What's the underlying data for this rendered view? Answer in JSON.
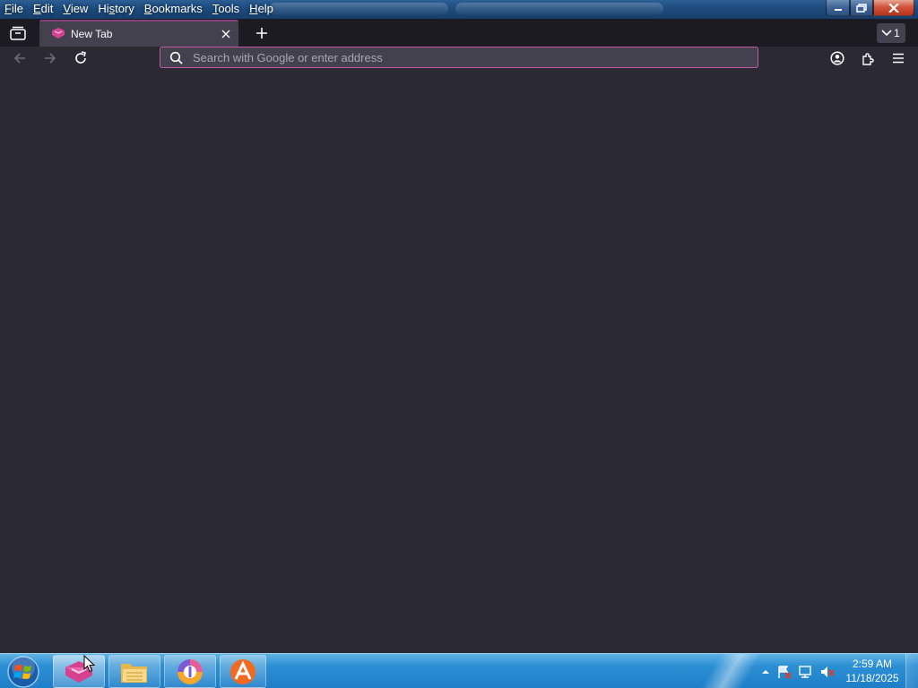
{
  "menubar": {
    "items": [
      {
        "pre": "",
        "key": "F",
        "post": "ile"
      },
      {
        "pre": "",
        "key": "E",
        "post": "dit"
      },
      {
        "pre": "",
        "key": "V",
        "post": "iew"
      },
      {
        "pre": "Hi",
        "key": "s",
        "post": "tory"
      },
      {
        "pre": "",
        "key": "B",
        "post": "ookmarks"
      },
      {
        "pre": "",
        "key": "T",
        "post": "ools"
      },
      {
        "pre": "",
        "key": "H",
        "post": "elp"
      }
    ]
  },
  "tabs": {
    "active_title": "New Tab",
    "tab_count": "1"
  },
  "urlbar": {
    "placeholder": "Search with Google or enter address",
    "value": ""
  },
  "taskbar": {
    "clock_time": "2:59 AM",
    "clock_date": "11/18/2025"
  },
  "colors": {
    "content_bg": "#2b2a33",
    "tabstrip_bg": "#1c1b22",
    "urlbar_border": "#c25aa8",
    "accent_pink": "#b83ea0",
    "taskbar_blue": "#1e7fc8"
  },
  "icons": [
    "tab-overview-icon",
    "browser-logo-icon",
    "close-icon",
    "plus-icon",
    "chevron-down-icon",
    "back-arrow-icon",
    "forward-arrow-icon",
    "reload-icon",
    "search-icon",
    "account-icon",
    "extensions-icon",
    "hamburger-menu-icon",
    "windows-logo-icon",
    "folder-icon",
    "app-icon",
    "flag-icon",
    "network-icon",
    "volume-muted-icon",
    "mouse-cursor-icon"
  ]
}
